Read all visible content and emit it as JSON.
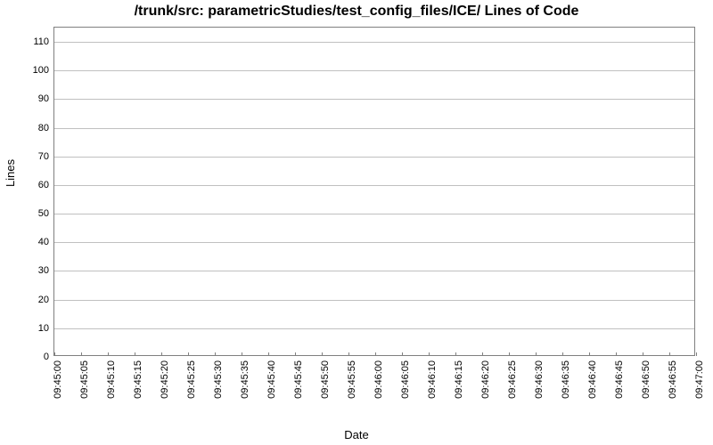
{
  "chart_data": {
    "type": "line",
    "title": "/trunk/src: parametricStudies/test_config_files/ICE/ Lines of Code",
    "xlabel": "Date",
    "ylabel": "Lines",
    "ylim": [
      0,
      115
    ],
    "yticks": [
      0,
      10,
      20,
      30,
      40,
      50,
      60,
      70,
      80,
      90,
      100,
      110
    ],
    "categories": [
      "09:45:00",
      "09:45:05",
      "09:45:10",
      "09:45:15",
      "09:45:20",
      "09:45:25",
      "09:45:30",
      "09:45:35",
      "09:45:40",
      "09:45:45",
      "09:45:50",
      "09:45:55",
      "09:46:00",
      "09:46:05",
      "09:46:10",
      "09:46:15",
      "09:46:20",
      "09:46:25",
      "09:46:30",
      "09:46:35",
      "09:46:40",
      "09:46:45",
      "09:46:50",
      "09:46:55",
      "09:47:00"
    ],
    "series": []
  }
}
